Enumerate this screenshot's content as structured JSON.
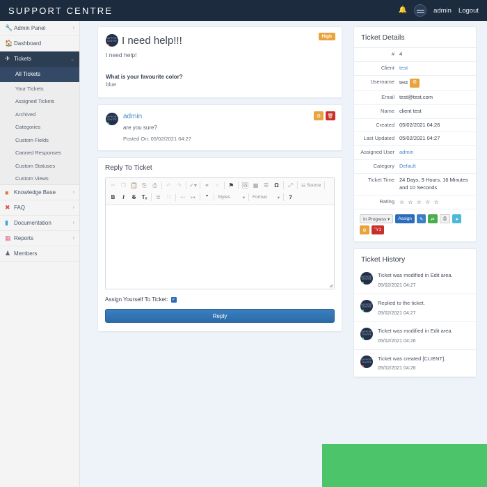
{
  "topbar": {
    "brand": "SUPPORT CENTRE",
    "bell_icon": "bell-icon",
    "avatar_icon": "user-avatar-icon",
    "username": "admin",
    "logout": "Logout"
  },
  "sidebar": {
    "items": [
      {
        "label": "Admin Panel",
        "icon": "wrench-icon",
        "caret": "›",
        "type": "top"
      },
      {
        "label": "Dashboard",
        "icon": "home-icon",
        "caret": "",
        "type": "top"
      },
      {
        "label": "Tickets",
        "icon": "ticket-icon",
        "caret": "⌄",
        "type": "expanded"
      }
    ],
    "ticket_subitems": [
      "All Tickets",
      "Your Tickets",
      "Assigned Tickets",
      "Archived",
      "Categories",
      "Custom Fields",
      "Canned Responses",
      "Custom Statuses",
      "Custom Views"
    ],
    "active_subitem": "All Tickets",
    "bottom_items": [
      {
        "label": "Knowledge Base",
        "icon": "book-icon",
        "caret": "›"
      },
      {
        "label": "FAQ",
        "icon": "question-circle-icon",
        "caret": "›"
      },
      {
        "label": "Documentation",
        "icon": "file-icon",
        "caret": "›"
      },
      {
        "label": "Reports",
        "icon": "chart-icon",
        "caret": "›"
      },
      {
        "label": "Members",
        "icon": "person-icon",
        "caret": ""
      }
    ]
  },
  "ticket": {
    "avatar": "support-centre-logo-avatar",
    "title": "I need help!!!",
    "body": "I need help!",
    "priority_badge": "High",
    "custom_field_label": "What is your favourite color?",
    "custom_field_value": "blue"
  },
  "reply_post": {
    "avatar": "support-centre-logo-avatar",
    "author": "admin",
    "text": "are you sure?",
    "meta": "Posted On: 05/02/2021 04:27",
    "edit_icon": "gear-icon",
    "delete_icon": "trash-icon"
  },
  "reply_form": {
    "title": "Reply To Ticket",
    "toolbar_row1": [
      {
        "name": "cut-icon",
        "glyph": "✂",
        "state": "faded"
      },
      {
        "name": "copy-icon",
        "glyph": "❐",
        "state": "faded"
      },
      {
        "name": "paste-icon",
        "glyph": "Ὄb",
        "state": "normal"
      },
      {
        "name": "paste-text-icon",
        "glyph": "⎘",
        "state": "normal"
      },
      {
        "name": "paste-word-icon",
        "glyph": "⎙",
        "state": "normal"
      },
      {
        "name": "undo-icon",
        "glyph": "↶",
        "state": "faded"
      },
      {
        "name": "redo-icon",
        "glyph": "↷",
        "state": "faded"
      },
      {
        "name": "spellcheck-icon",
        "glyph": "✓",
        "state": "normal"
      },
      {
        "name": "link-icon",
        "glyph": "⚭",
        "state": "normal"
      },
      {
        "name": "unlink-icon",
        "glyph": "⚬",
        "state": "faded"
      },
      {
        "name": "anchor-icon",
        "glyph": "⚑",
        "state": "dark"
      },
      {
        "name": "image-icon",
        "glyph": "Ὓc",
        "state": "normal"
      },
      {
        "name": "table-icon",
        "glyph": "▦",
        "state": "normal"
      },
      {
        "name": "horizontal-rule-icon",
        "glyph": "☰",
        "state": "normal"
      },
      {
        "name": "special-char-icon",
        "glyph": "Ω",
        "state": "dark"
      },
      {
        "name": "maximize-icon",
        "glyph": "⤢",
        "state": "normal"
      }
    ],
    "source_label": "Source",
    "toolbar_row2": [
      {
        "name": "bold-icon",
        "glyph": "B",
        "state": "dark"
      },
      {
        "name": "italic-icon",
        "glyph": "I",
        "state": "dark"
      },
      {
        "name": "strikethrough-icon",
        "glyph": "S",
        "state": "dark"
      },
      {
        "name": "remove-format-icon",
        "glyph": "Tₓ",
        "state": "dark"
      },
      {
        "name": "numbered-list-icon",
        "glyph": "≣",
        "state": "normal"
      },
      {
        "name": "bulleted-list-icon",
        "glyph": "∷",
        "state": "normal"
      },
      {
        "name": "outdent-icon",
        "glyph": "←",
        "state": "faded"
      },
      {
        "name": "indent-icon",
        "glyph": "→",
        "state": "normal"
      },
      {
        "name": "blockquote-icon",
        "glyph": "”",
        "state": "dark"
      }
    ],
    "styles_combo": "Styles",
    "format_combo": "Format",
    "help_icon": "question-mark-icon",
    "editor_value": "",
    "assign_label": "Assign Yourself To Ticket:",
    "assign_checked": true,
    "submit_label": "Reply"
  },
  "details": {
    "title": "Ticket Details",
    "rows": [
      {
        "key": "#",
        "value": "4",
        "style": "plain"
      },
      {
        "key": "Client",
        "value": "test",
        "style": "link"
      },
      {
        "key": "Username",
        "value": "test",
        "style": "plain",
        "badge": "gear-icon"
      },
      {
        "key": "Email",
        "value": "test@test.com",
        "style": "plain"
      },
      {
        "key": "Name",
        "value": "client test",
        "style": "plain"
      },
      {
        "key": "Created",
        "value": "05/02/2021 04:26",
        "style": "plain"
      },
      {
        "key": "Last Updated",
        "value": "05/02/2021 04:27",
        "style": "plain"
      },
      {
        "key": "Assigned User",
        "value": "admin",
        "style": "link"
      },
      {
        "key": "Category",
        "value": "Default",
        "style": "link"
      },
      {
        "key": "Ticket Time",
        "value": "24 Days, 9 Hours, 16 Minutes and 10 Seconds",
        "style": "plain"
      },
      {
        "key": "Rating",
        "value": "☆ ☆ ☆ ☆ ☆",
        "style": "stars"
      }
    ],
    "actions": [
      {
        "name": "status-dropdown",
        "label": "In Progress ▾",
        "color": "b-status"
      },
      {
        "name": "assign-button",
        "label": "Assign",
        "color": "b-blue"
      },
      {
        "name": "edit-button",
        "label": "✎",
        "color": "b-blue2"
      },
      {
        "name": "transfer-button",
        "label": "⇄",
        "color": "b-green"
      },
      {
        "name": "print-button",
        "label": "⎙",
        "color": "b-white"
      },
      {
        "name": "send-button",
        "label": "➤",
        "color": "b-cyan"
      },
      {
        "name": "settings-button",
        "label": "⚙",
        "color": "b-orange"
      },
      {
        "name": "delete-button",
        "label": "Ὕ1",
        "color": "b-red"
      }
    ]
  },
  "history": {
    "title": "Ticket History",
    "items": [
      {
        "avatar": "support-centre-logo-avatar",
        "text": "Ticket was modified in Edit area.",
        "date": "05/02/2021 04:27"
      },
      {
        "avatar": "support-centre-logo-avatar",
        "text": "Replied to the ticket.",
        "date": "05/02/2021 04:27"
      },
      {
        "avatar": "support-centre-logo-avatar",
        "text": "Ticket was modified in Edit area.",
        "date": "05/02/2021 04:26"
      },
      {
        "avatar": "support-centre-logo-avatar",
        "text": "Ticket was created [CLIENT].",
        "date": "05/02/2021 04:26"
      }
    ]
  },
  "overlay": {
    "name": "green-overlay-block",
    "color": "#4cc46a"
  }
}
